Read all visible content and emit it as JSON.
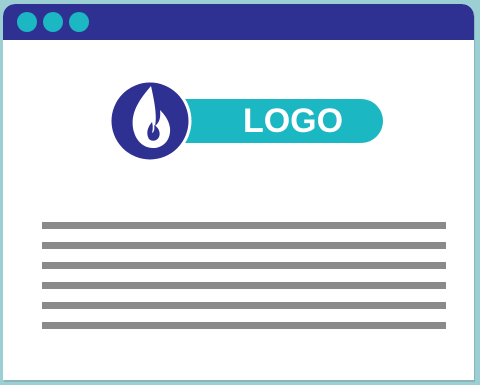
{
  "window": {
    "titlebar_color": "#2e3192",
    "traffic_dots": [
      "dot",
      "dot",
      "dot"
    ],
    "dot_color": "#1bb7c2"
  },
  "logo": {
    "text": "LOGO",
    "icon": "flame-icon",
    "pill_color": "#1bb7c2",
    "emblem_color": "#2e3192"
  },
  "content": {
    "text_line_placeholders": 6,
    "line_color": "#8a8a8a"
  }
}
